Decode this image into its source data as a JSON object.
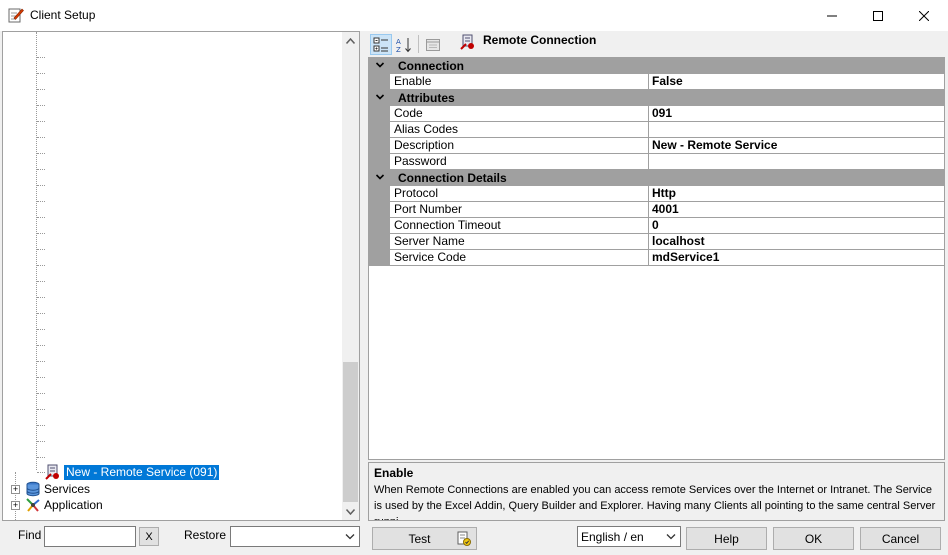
{
  "window": {
    "title": "Client Setup"
  },
  "tree": {
    "selected_item": "New - Remote Service (091)",
    "root_items": [
      {
        "label": "Services"
      },
      {
        "label": "Application"
      }
    ]
  },
  "property_grid": {
    "caption": "Remote Connection",
    "categories": [
      {
        "label": "Connection"
      },
      {
        "label": "Attributes"
      },
      {
        "label": "Connection Details"
      }
    ],
    "properties": {
      "enable": {
        "name": "Enable",
        "value": "False"
      },
      "code": {
        "name": "Code",
        "value": "091"
      },
      "alias_codes": {
        "name": "Alias Codes",
        "value": ""
      },
      "description": {
        "name": "Description",
        "value": "New - Remote Service"
      },
      "password": {
        "name": "Password",
        "value": ""
      },
      "protocol": {
        "name": "Protocol",
        "value": "Http"
      },
      "port_number": {
        "name": "Port Number",
        "value": "4001"
      },
      "connection_timeout": {
        "name": "Connection Timeout",
        "value": "0"
      },
      "server_name": {
        "name": "Server Name",
        "value": "localhost"
      },
      "service_code": {
        "name": "Service Code",
        "value": "mdService1"
      }
    }
  },
  "description_panel": {
    "title": "Enable",
    "text": "When Remote Connections are enabled you can access remote Services over the Internet or Intranet. The Service is used by the Excel Addin, Query Builder and Explorer. Having many Clients all pointing to the same central Server runni..."
  },
  "bottom_bar": {
    "find_label": "Find",
    "find_value": "",
    "clear_button": "X",
    "restore_label": "Restore",
    "restore_value": "",
    "test_button": "Test",
    "language_value": "English / en",
    "help_button": "Help",
    "ok_button": "OK",
    "cancel_button": "Cancel"
  },
  "icons": {
    "app": "edit-pencil-icon",
    "categorized": "categorized-view-icon",
    "alphabetical": "alphabetical-sort-icon",
    "property_pages": "property-pages-icon",
    "remote_connection": "remote-connection-icon",
    "services": "database-icon",
    "application": "application-icon",
    "test": "test-connection-icon"
  },
  "colors": {
    "selection": "#0078d7",
    "category_band": "#a0a0a0",
    "window_bg": "#f0f0f0"
  }
}
